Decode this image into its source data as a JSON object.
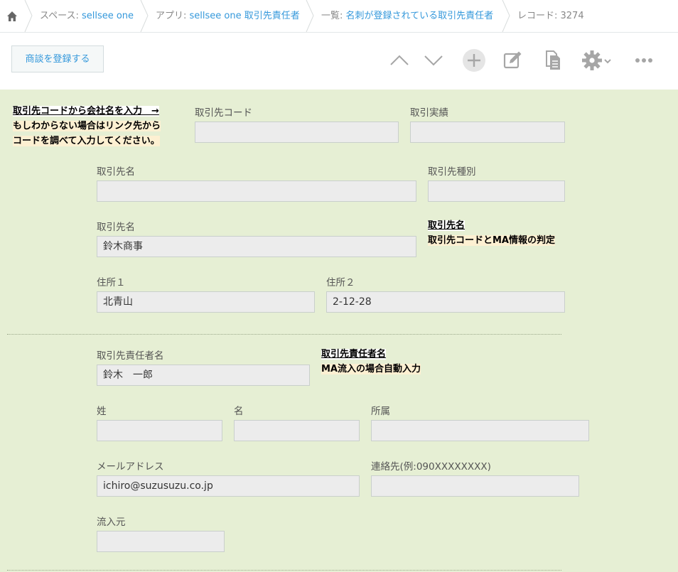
{
  "breadcrumb": {
    "space_prefix": "スペース: ",
    "space_name": "sellsee one",
    "app_prefix": "アプリ: ",
    "app_name": "sellsee one 取引先責任者",
    "list_prefix": "一覧: ",
    "list_name": "名刺が登録されている取引先責任者",
    "record": "レコード: 3274"
  },
  "toolbar": {
    "register_deal_label": "商談を登録する"
  },
  "form": {
    "note_code_line1": "取引先コードから会社名を入力　→",
    "note_code_line2": "もしわからない場合はリンク先から",
    "note_code_line3": "コードを調べて入力してください。",
    "client_code_label": "取引先コード",
    "client_code_value": "",
    "trade_record_label": "取引実績",
    "trade_record_value": "",
    "client_name_label": "取引先名",
    "client_name_value": "",
    "client_type_label": "取引先種別",
    "client_type_value": "",
    "client_name2_label": "取引先名",
    "client_name2_value": "鈴木商事",
    "note_client_line1": "取引先名",
    "note_client_line2": "取引先コードとMA情報の判定",
    "address1_label": "住所１",
    "address1_value": "北青山",
    "address2_label": "住所２",
    "address2_value": "2-12-28",
    "contact_name_label": "取引先責任者名",
    "contact_name_value": "鈴木　一郎",
    "note_contact_line1": "取引先責任者名",
    "note_contact_line2": "MA流入の場合自動入力",
    "last_name_label": "姓",
    "last_name_value": "",
    "first_name_label": "名",
    "first_name_value": "",
    "affiliation_label": "所属",
    "affiliation_value": "",
    "email_label": "メールアドレス",
    "email_value": "ichiro@suzusuzu.co.jp",
    "phone_label": "連絡先(例:090XXXXXXXX)",
    "phone_value": "",
    "source_label": "流入元",
    "source_value": ""
  }
}
